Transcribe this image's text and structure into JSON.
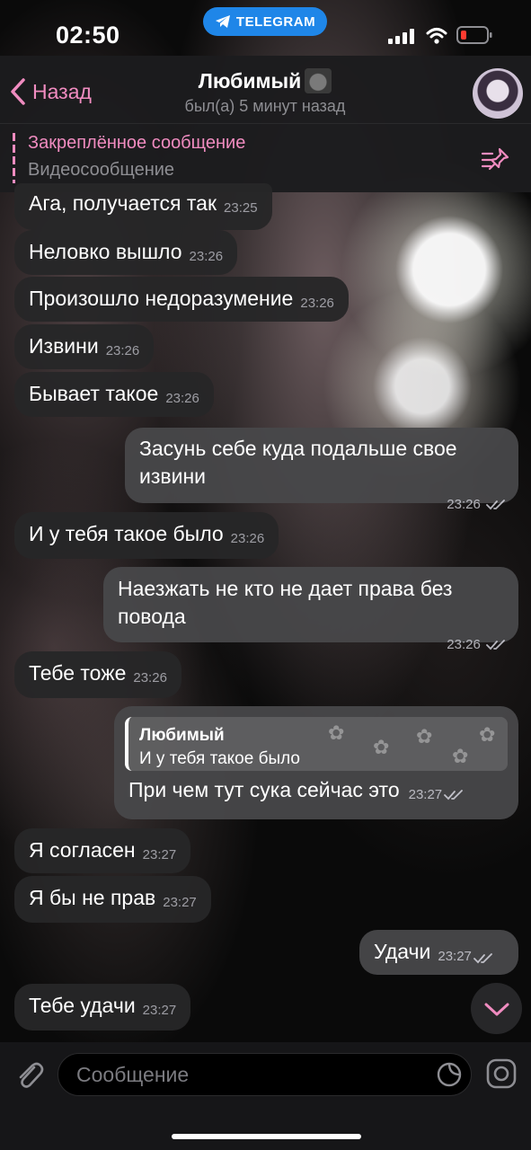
{
  "status_bar": {
    "time": "02:50",
    "pill_label": "TELEGRAM"
  },
  "header": {
    "back_label": "Назад",
    "title": "Любимый",
    "subtitle": "был(а) 5 минут назад"
  },
  "pinned": {
    "title": "Закреплённое сообщение",
    "text": "Видеосообщение"
  },
  "messages": [
    {
      "dir": "in",
      "text": "Ага, получается так",
      "time": "23:25"
    },
    {
      "dir": "in",
      "text": "Неловко вышло",
      "time": "23:26"
    },
    {
      "dir": "in",
      "text": "Произошло недоразумение",
      "time": "23:26"
    },
    {
      "dir": "in",
      "text": "Извини",
      "time": "23:26"
    },
    {
      "dir": "in",
      "text": "Бывает такое",
      "time": "23:26"
    },
    {
      "dir": "out",
      "text": "Засунь себе куда подальше свое извини",
      "time": "23:26"
    },
    {
      "dir": "in",
      "text": "И у тебя такое было",
      "time": "23:26"
    },
    {
      "dir": "out",
      "text": "Наезжать не кто не дает права без повода",
      "time": "23:26"
    },
    {
      "dir": "in",
      "text": "Тебе тоже",
      "time": "23:26"
    },
    {
      "dir": "out",
      "text": "При чем тут сука сейчас это",
      "time": "23:27",
      "reply": {
        "name": "Любимый",
        "text": "И у тебя такое было"
      }
    },
    {
      "dir": "in",
      "text": "Я согласен",
      "time": "23:27"
    },
    {
      "dir": "in",
      "text": "Я бы не прав",
      "time": "23:27"
    },
    {
      "dir": "out",
      "text": "Удачи",
      "time": "23:27"
    },
    {
      "dir": "in",
      "text": "Тебе удачи",
      "time": "23:27"
    }
  ],
  "input": {
    "placeholder": "Сообщение"
  },
  "colors": {
    "accent": "#f08cc0",
    "telegram_blue": "#1f86e8",
    "battery_low": "#ff3b30"
  },
  "icons": [
    "telegram-icon",
    "signal-icon",
    "wifi-icon",
    "battery-icon",
    "back-chevron-icon",
    "pin-icon",
    "double-check-icon",
    "chevron-down-icon",
    "paperclip-icon",
    "sticker-icon",
    "camera-icon"
  ]
}
